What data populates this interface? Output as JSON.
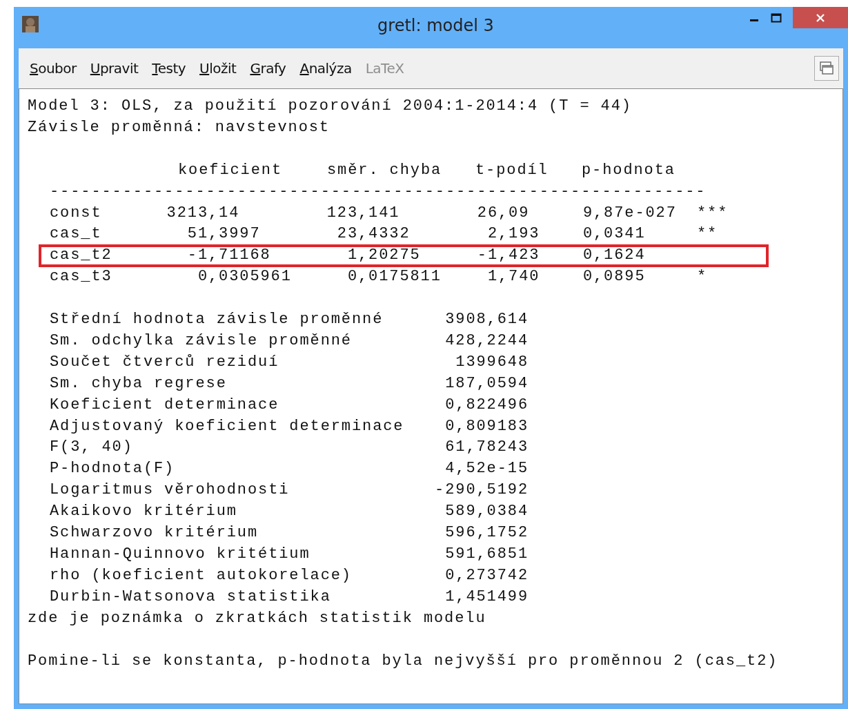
{
  "window": {
    "title": "gretl: model 3"
  },
  "menu": [
    {
      "label": "Soubor",
      "disabled": false
    },
    {
      "label": "Upravit",
      "disabled": false
    },
    {
      "label": "Testy",
      "disabled": false
    },
    {
      "label": "Uložit",
      "disabled": false
    },
    {
      "label": "Grafy",
      "disabled": false
    },
    {
      "label": "Analýza",
      "disabled": false
    },
    {
      "label": "LaTeX",
      "disabled": true
    }
  ],
  "output": {
    "heading": [
      "Model 3: OLS, za použití pozorování 2004:1-2014:4 (T = 44)",
      "Závisle proměnná: navstevnost"
    ],
    "columns": [
      "koeficient",
      "směr. chyba",
      "t-podíl",
      "p-hodnota"
    ],
    "rule": "---------------------------------------------------------------",
    "rows": [
      {
        "name": "const",
        "values": [
          "3213,14",
          "123,141",
          "26,09",
          "9,87e-027"
        ],
        "stars": "***",
        "highlighted": false
      },
      {
        "name": "cas_t",
        "values": [
          "51,3997",
          "23,4332",
          "2,193",
          "0,0341"
        ],
        "stars": "**",
        "highlighted": false
      },
      {
        "name": "cas_t2",
        "values": [
          "-1,71168",
          "1,20275",
          "-1,423",
          "0,1624"
        ],
        "highlighted": true
      },
      {
        "name": "cas_t3",
        "values": [
          "0,0305961",
          "0,0175811",
          "1,740",
          "0,0895"
        ],
        "stars": "*",
        "highlighted": false
      }
    ],
    "stats": [
      {
        "label": "Střední hodnota závisle proměnné",
        "value": "3908,614"
      },
      {
        "label": "Sm. odchylka závisle proměnné",
        "value": "428,2244"
      },
      {
        "label": "Součet čtverců reziduí",
        "value": "1399648"
      },
      {
        "label": "Sm. chyba regrese",
        "value": "187,0594"
      },
      {
        "label": "Koeficient determinace",
        "value": "0,822496"
      },
      {
        "label": "Adjustovaný koeficient determinace",
        "value": "0,809183"
      },
      {
        "label": "F(3, 40)",
        "value": "61,78243"
      },
      {
        "label": "P-hodnota(F)",
        "value": "4,52e-15"
      },
      {
        "label": "Logaritmus věrohodnosti",
        "value": "-290,5192"
      },
      {
        "label": "Akaikovo kritérium",
        "value": "589,0384"
      },
      {
        "label": "Schwarzovo kritérium",
        "value": "596,1752"
      },
      {
        "label": "Hannan-Quinnovo kritétium",
        "value": "591,6851"
      },
      {
        "label": "rho (koeficient autokorelace)",
        "value": "0,273742"
      },
      {
        "label": "Durbin-Watsonova statistika",
        "value": "1,451499"
      }
    ],
    "note": "zde je poznámka o zkratkách statistik modelu",
    "footer": "Pomine-li se konstanta, p-hodnota byla nejvyšší pro proměnnou 2 (cas_t2)"
  }
}
